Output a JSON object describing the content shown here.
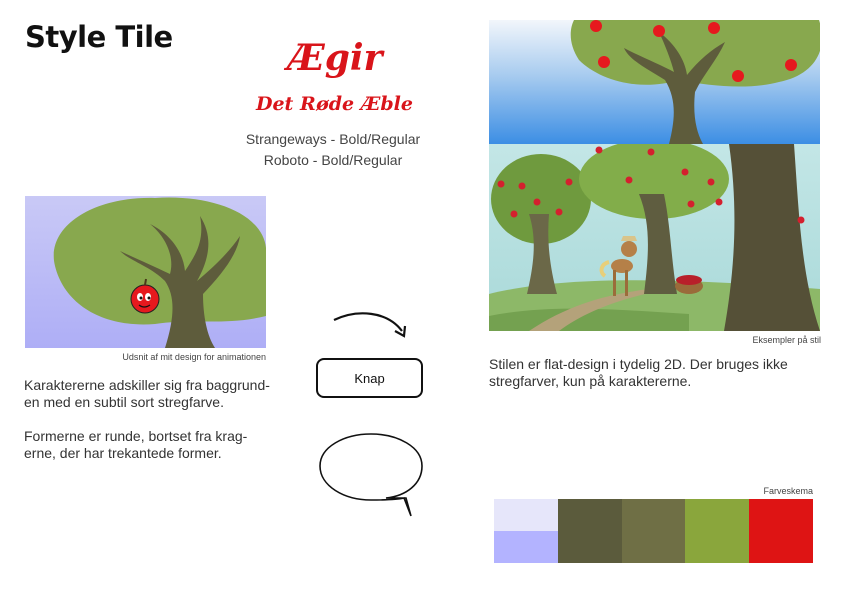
{
  "header": {
    "title": "Style Tile"
  },
  "logo": {
    "name": "Ægir",
    "subtitle": "Det Røde Æble"
  },
  "fonts": {
    "line1": "Strangeways - Bold/Regular",
    "line2": "Roboto - Bold/Regular"
  },
  "animation_example": {
    "caption": "Udsnit af mit design for animationen",
    "image_icon": "apple-tree-character"
  },
  "description_left": {
    "paragraph1": "Karaktererne adskiller sig fra baggrund-en med en subtil sort stregfarve.",
    "paragraph2": "Formerne er runde, bortset fra krag-erne, der har trekantede former."
  },
  "ui_elements": {
    "button_label": "Knap",
    "arrow_icon": "curved-arrow-icon",
    "bubble_icon": "speech-bubble-icon"
  },
  "examples": {
    "caption": "Eksempler på stil",
    "text": "Stilen er flat-design i tydelig 2D. Der bruges ikke stregfarver, kun på karaktererne."
  },
  "palette": {
    "caption": "Farveskema",
    "colors": [
      "#e6e6fa",
      "#b3b3ff",
      "#5b5b3c",
      "#6f6f45",
      "#8aa63c",
      "#de1414"
    ]
  }
}
